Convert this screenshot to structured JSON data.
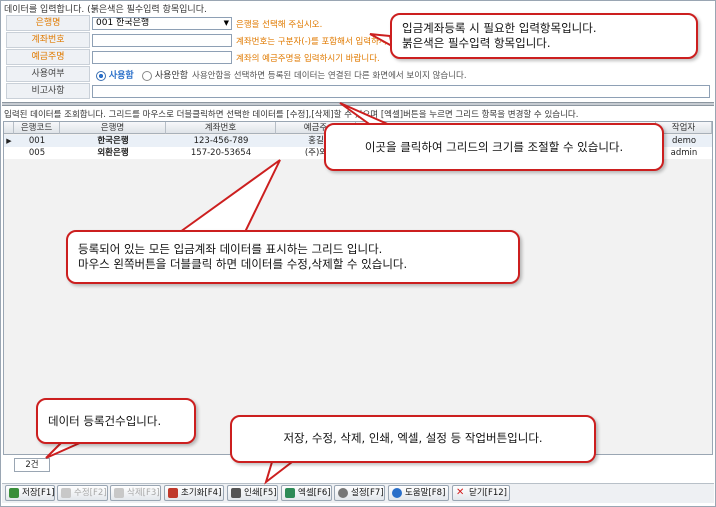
{
  "form": {
    "caption": "데이터를 입력합니다. (붉은색은 필수입력 항목입니다.",
    "fields": [
      {
        "label": "은행명",
        "value": "001 한국은행",
        "hint": "은행을 선택해 주십시오."
      },
      {
        "label": "계좌번호",
        "value": "",
        "hint": "계좌번호는 구분자(-)를 포함해서 입력하시기 바랍니다."
      },
      {
        "label": "예금주명",
        "value": "",
        "hint": "계좌의 예금주명을 입력하시기 바랍니다."
      },
      {
        "label": "사용여부",
        "option_on": "사용함",
        "option_off": "사용안함",
        "hint": "사용안함을 선택하면 등록된 데이터는 연결된 다른 화면에서 보이지 않습니다."
      },
      {
        "label": "비고사항",
        "value": ""
      }
    ]
  },
  "grid": {
    "caption": "입력된 데이터를 조회합니다. 그리드를 마우스로 더블클릭하면 선택한 데이터를 [수정],[삭제]할 수 있으며 [엑셀]버튼을 누르면 그리드 항목을 변경할 수 있습니다.",
    "columns": [
      "은행코드",
      "은행명",
      "계좌번호",
      "예금주",
      "작업자"
    ],
    "rows": [
      {
        "code": "001",
        "bank": "한국은행",
        "account": "123-456-789",
        "owner": "홍길",
        "worker": "demo"
      },
      {
        "code": "005",
        "bank": "외환은행",
        "account": "157-20-53654",
        "owner": "(주)외",
        "worker": "admin"
      }
    ],
    "count": "2건"
  },
  "toolbar": {
    "buttons": [
      {
        "label": "저장[F1]",
        "enabled": true,
        "color": "#3a8f3a"
      },
      {
        "label": "수정[F2]",
        "enabled": false,
        "color": "#b0b0b0"
      },
      {
        "label": "삭제[F3]",
        "enabled": false,
        "color": "#b0b0b0"
      },
      {
        "label": "초기화[F4]",
        "enabled": true,
        "color": "#c0392b"
      },
      {
        "label": "인쇄[F5]",
        "enabled": true,
        "color": "#555555"
      },
      {
        "label": "엑셀[F6]",
        "enabled": true,
        "color": "#2e8b57"
      },
      {
        "label": "설정[F7]",
        "enabled": true,
        "color": "#777777"
      },
      {
        "label": "도움말[F8]",
        "enabled": true,
        "color": "#2a6fc9"
      },
      {
        "label": "닫기[F12]",
        "enabled": true,
        "color": "#d11a1a"
      }
    ]
  },
  "callouts": {
    "required": "입금계좌등록 시 필요한 입력항목입니다.\n붉은색은 필수입력 항목입니다.",
    "splitter": "이곳을 클릭하여 그리드의 크기를 조절할 수 있습니다.",
    "grid": "등록되어 있는 모든 입금계좌 데이터를 표시하는 그리드 입니다.\n마우스 왼쪽버튼을 더블클릭 하면 데이터를 수정,삭제할 수 있습니다.",
    "count": "데이터 등록건수입니다.",
    "toolbar": "저장, 수정, 삭제, 인쇄, 엑셀, 설정 등 작업버튼입니다."
  },
  "colors": {
    "required_label": "#e07a00",
    "callout_border": "#cc1f1f"
  }
}
